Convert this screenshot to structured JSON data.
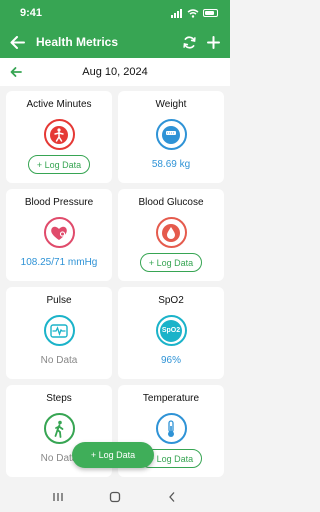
{
  "status_bar": {
    "time": "9:41"
  },
  "app_bar": {
    "title": "Health Metrics"
  },
  "date_bar": {
    "date": "Aug 10, 2024"
  },
  "metrics": [
    {
      "label": "Active Minutes",
      "value": "",
      "log_label": "+ Log Data",
      "icon": "person-activity-icon",
      "color": "#e53935"
    },
    {
      "label": "Weight",
      "value": "58.69 kg",
      "log_label": "",
      "icon": "scale-icon",
      "color": "#2f93d6"
    },
    {
      "label": "Blood Pressure",
      "value": "108.25/71 mmHg",
      "log_label": "",
      "icon": "heart-icon",
      "color": "#e04b6b"
    },
    {
      "label": "Blood Glucose",
      "value": "",
      "log_label": "+ Log Data",
      "icon": "blood-drop-icon",
      "color": "#e55b4d"
    },
    {
      "label": "Pulse",
      "value": "No Data",
      "log_label": "",
      "icon": "pulse-icon",
      "color": "#1bb3c9"
    },
    {
      "label": "SpO2",
      "value": "96%",
      "log_label": "",
      "icon_text": "SpO2",
      "icon": "spo2-icon",
      "color": "#1bb3c9"
    },
    {
      "label": "Steps",
      "value": "No Data",
      "log_label": "",
      "icon": "walking-icon",
      "color": "#37a553"
    },
    {
      "label": "Temperature",
      "value": "",
      "log_label": "+ Log Data",
      "icon": "thermometer-icon",
      "color": "#2f93d6"
    }
  ],
  "fab": {
    "label": "+ Log Data"
  },
  "colors": {
    "primary": "#37a553",
    "value_blue": "#2f93d6",
    "background": "#f3f3f3"
  }
}
